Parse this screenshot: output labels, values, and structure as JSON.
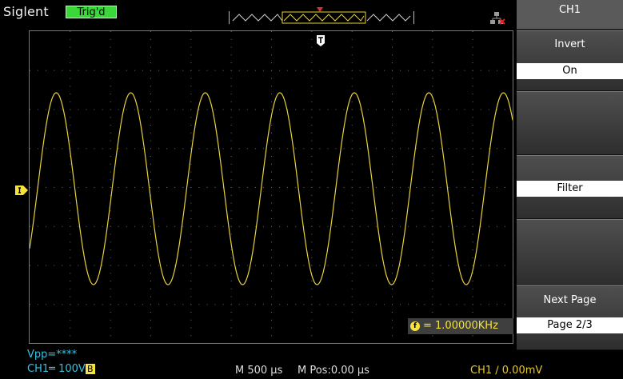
{
  "header": {
    "brand": "Siglent",
    "trigger_status": "Trig'd"
  },
  "measurement": {
    "frequency": "= 1.00000KHz"
  },
  "menu": {
    "title": "CH1",
    "invert_label": "Invert",
    "invert_value": "On",
    "filter_label": "Filter",
    "next_page_label": "Next Page",
    "page_value": "Page 2/3"
  },
  "status": {
    "vpp": "Vpp=****",
    "ch1_scale": "CH1═ 100V",
    "bandwidth_badge": "B",
    "timebase": "M 500 µs",
    "mpos": "M Pos:0.00 µs",
    "trigger_level": "CH1 ∕ 0.00mV"
  },
  "colors": {
    "trace": "#e8d23a",
    "trig_green": "#3ad63a",
    "status_cyan": "#2ec6e6"
  },
  "icons": {
    "network": "network-disconnected-icon",
    "trigger_time": "trigger-position-icon",
    "channel": "channel1-marker-icon"
  }
}
